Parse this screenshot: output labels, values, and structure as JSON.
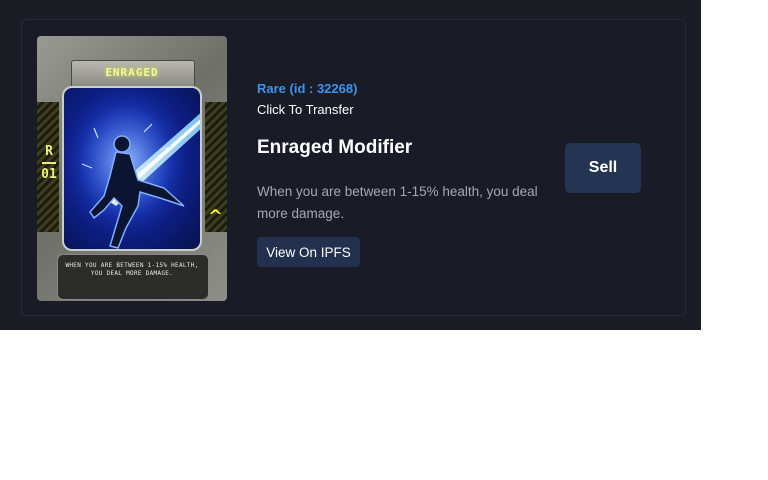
{
  "nft_card": {
    "art_title": "ENRAGED",
    "art_rarity_letter": "R",
    "art_rarity_number": "01",
    "art_chevron_icon": "chevron-up-icon",
    "art_description": "WHEN YOU ARE BETWEEN 1-15% HEALTH, YOU DEAL MORE DAMAGE.",
    "rarity_label": "Rare (id : 32268)",
    "transfer_label": "Click To Transfer",
    "title": "Enraged Modifier",
    "description": "When you are between 1-15% health, you deal more damage.",
    "ipfs_button_label": "View On IPFS",
    "sell_button_label": "Sell"
  },
  "colors": {
    "rarity_accent": "#3d95e8",
    "button_bg": "#243453",
    "card_bg": "#191b27",
    "art_accent": "#e8f23c"
  }
}
